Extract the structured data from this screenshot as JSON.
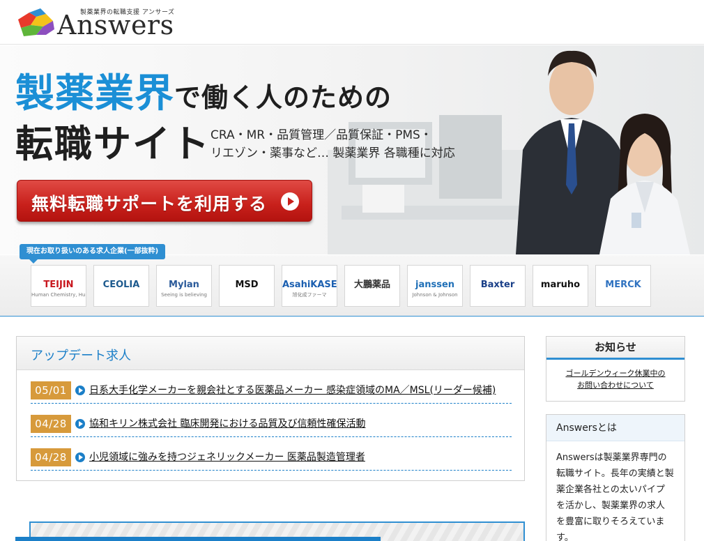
{
  "header": {
    "tagline": "製薬業界の転職支援 アンサーズ",
    "logo_word": "Answers"
  },
  "hero": {
    "headline_blue": "製薬業界",
    "headline_rest": "で働く人のための",
    "headline_line2": "転職サイト",
    "sub_line1": "CRA・MR・品質管理／品質保証・PMS・",
    "sub_line2": "リエゾン・薬事など… 製薬業界 各職種に対応",
    "cta_label": "無料転職サポートを利用する"
  },
  "companies": {
    "tag": "現在お取り扱いのある求人企業(一部抜粋)",
    "logos": [
      {
        "name": "TEIJIN",
        "sub": "Human Chemistry, Human Solutions",
        "color": "#c8171e"
      },
      {
        "name": "CEOLIA",
        "sub": "",
        "color": "#1d5a8e"
      },
      {
        "name": "Mylan",
        "sub": "Seeing is believing",
        "color": "#2a5a9a"
      },
      {
        "name": "MSD",
        "sub": "",
        "color": "#111111"
      },
      {
        "name": "AsahiKASEI",
        "sub": "旭化成ファーマ",
        "color": "#1b5fb0"
      },
      {
        "name": "大鵬薬品",
        "sub": "",
        "color": "#333333"
      },
      {
        "name": "janssen",
        "sub": "Johnson & Johnson",
        "color": "#1f6fb7"
      },
      {
        "name": "Baxter",
        "sub": "",
        "color": "#1a3f88"
      },
      {
        "name": "maruho",
        "sub": "",
        "color": "#111111"
      },
      {
        "name": "MERCK",
        "sub": "",
        "color": "#2f72c0"
      }
    ]
  },
  "jobs": {
    "title": "アップデート求人",
    "items": [
      {
        "date": "05/01",
        "text": "日系大手化学メーカーを親会社とする医薬品メーカー 感染症領域のMA／MSL(リーダー候補)"
      },
      {
        "date": "04/28",
        "text": "協和キリン株式会社 臨床開発における品質及び信頼性確保活動"
      },
      {
        "date": "04/28",
        "text": "小児領域に強みを持つジェネリックメーカー 医薬品製造管理者"
      }
    ]
  },
  "news": {
    "title": "お知らせ",
    "link_line1": "ゴールデンウィーク休業中の",
    "link_line2": "お問い合わせについて"
  },
  "about": {
    "title": "Answersとは",
    "lines": [
      "Answersは製薬業界専門の",
      "転職サイト。長年の実績と製",
      "薬企業各社との太いパイプ",
      "を活かし、製薬業界の求人",
      "を豊富に取りそろえていま",
      "す。"
    ]
  }
}
